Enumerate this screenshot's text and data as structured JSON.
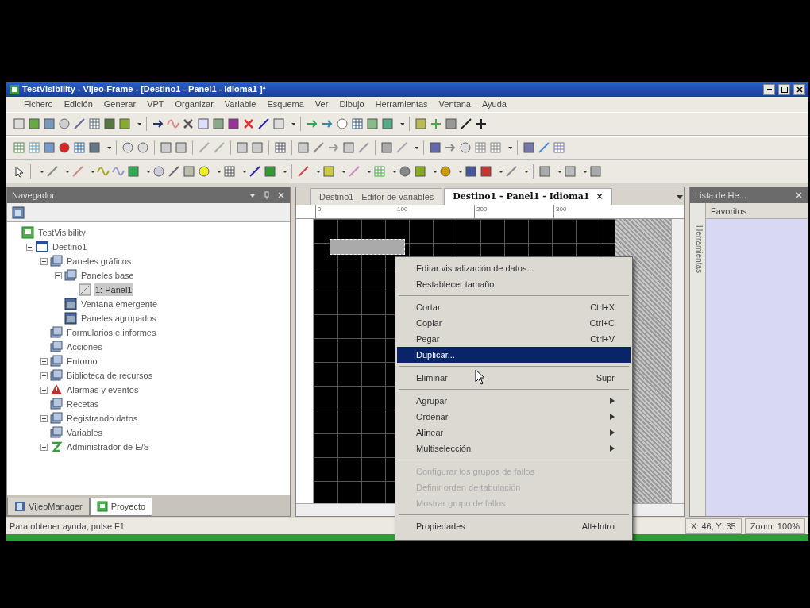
{
  "window": {
    "title": "TestVisibility - Vijeo-Frame - [Destino1 - Panel1 - Idioma1 ]*"
  },
  "menu_bar": [
    "Fichero",
    "Edición",
    "Generar",
    "VPT",
    "Organizar",
    "Variable",
    "Esquema",
    "Ver",
    "Dibujo",
    "Herramientas",
    "Ventana",
    "Ayuda"
  ],
  "navigator": {
    "title": "Navegador",
    "tree": [
      {
        "label": "TestVisibility",
        "kind": "project",
        "selected": false,
        "children": [
          {
            "label": "Destino1",
            "kind": "target",
            "selected": false,
            "expanded": true,
            "children": [
              {
                "label": "Paneles gráficos",
                "kind": "folder",
                "selected": false,
                "expanded": true,
                "children": [
                  {
                    "label": "Paneles base",
                    "kind": "folder",
                    "selected": false,
                    "expanded": true,
                    "children": [
                      {
                        "label": "1: Panel1",
                        "kind": "panel",
                        "selected": true
                      }
                    ]
                  },
                  {
                    "label": "Ventana emergente",
                    "kind": "window",
                    "selected": false
                  },
                  {
                    "label": "Paneles agrupados",
                    "kind": "window",
                    "selected": false
                  }
                ]
              },
              {
                "label": "Formularios e informes",
                "kind": "folder",
                "selected": false
              },
              {
                "label": "Acciones",
                "kind": "folder",
                "selected": false
              },
              {
                "label": "Entorno",
                "kind": "folder",
                "selected": false,
                "expanded": false
              },
              {
                "label": "Biblioteca de recursos",
                "kind": "folder",
                "selected": false,
                "expanded": false
              },
              {
                "label": "Alarmas y eventos",
                "kind": "alarm",
                "selected": false,
                "expanded": false
              },
              {
                "label": "Recetas",
                "kind": "folder",
                "selected": false
              },
              {
                "label": "Registrando datos",
                "kind": "folder",
                "selected": false,
                "expanded": false
              },
              {
                "label": "Variables",
                "kind": "folder",
                "selected": false
              },
              {
                "label": "Administrador de E/S",
                "kind": "io",
                "selected": false,
                "expanded": false
              }
            ]
          }
        ]
      }
    ],
    "tabs": [
      {
        "label": "VijeoManager",
        "selected": false
      },
      {
        "label": "Proyecto",
        "selected": true
      }
    ]
  },
  "editor": {
    "tabs": [
      {
        "label": "Destino1 - Editor de variables",
        "selected": false
      },
      {
        "label": "Destino1 - Panel1 - Idioma1",
        "selected": true,
        "close": "×"
      }
    ],
    "ruler": [
      "0",
      "100",
      "200",
      "300"
    ]
  },
  "context_menu": {
    "items": [
      {
        "kind": "item",
        "label": "Editar visualización de datos...",
        "selected": false,
        "disabled": false
      },
      {
        "kind": "item",
        "label": "Restablecer tamaño",
        "selected": false,
        "disabled": false
      },
      {
        "kind": "separator"
      },
      {
        "kind": "item",
        "label": "Cortar",
        "shortcut": "Ctrl+X",
        "selected": false,
        "disabled": false
      },
      {
        "kind": "item",
        "label": "Copiar",
        "shortcut": "Ctrl+C",
        "selected": false,
        "disabled": false
      },
      {
        "kind": "item",
        "label": "Pegar",
        "shortcut": "Ctrl+V",
        "selected": false,
        "disabled": false
      },
      {
        "kind": "item",
        "label": "Duplicar...",
        "selected": true,
        "disabled": false
      },
      {
        "kind": "separator"
      },
      {
        "kind": "item",
        "label": "Eliminar",
        "shortcut": "Supr",
        "selected": false,
        "disabled": false
      },
      {
        "kind": "separator"
      },
      {
        "kind": "submenu",
        "label": "Agrupar",
        "selected": false,
        "disabled": false
      },
      {
        "kind": "submenu",
        "label": "Ordenar",
        "selected": false,
        "disabled": false
      },
      {
        "kind": "submenu",
        "label": "Alinear",
        "selected": false,
        "disabled": false
      },
      {
        "kind": "submenu",
        "label": "Multiselección",
        "selected": false,
        "disabled": false
      },
      {
        "kind": "separator"
      },
      {
        "kind": "item",
        "label": "Configurar los grupos de fallos",
        "selected": false,
        "disabled": true
      },
      {
        "kind": "item",
        "label": "Definir orden de tabulación",
        "selected": false,
        "disabled": true
      },
      {
        "kind": "item",
        "label": "Mostrar grupo de fallos",
        "selected": false,
        "disabled": true
      },
      {
        "kind": "separator"
      },
      {
        "kind": "item",
        "label": "Propiedades",
        "shortcut": "Alt+Intro",
        "selected": false,
        "disabled": false
      }
    ]
  },
  "right_panel": {
    "title": "Lista de He...",
    "header": "Favoritos",
    "side_tab": "Herramientas"
  },
  "status_bar": [
    "Para obtener ayuda, pulse F1",
    "X: 46, Y: 35",
    "Zoom: 100%"
  ]
}
